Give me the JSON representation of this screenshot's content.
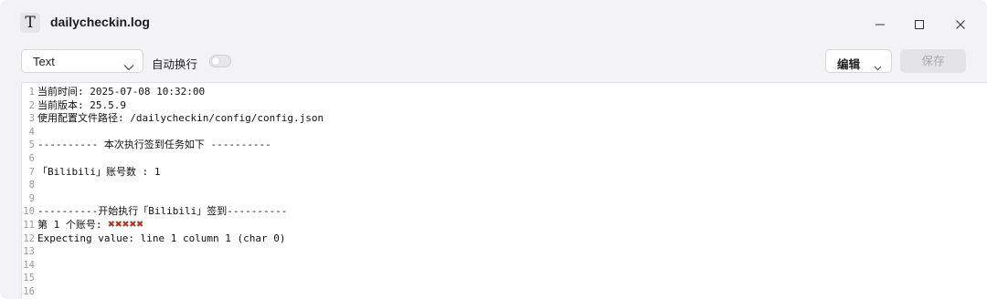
{
  "window": {
    "title": "dailycheckin.log",
    "app_icon_glyph": "T",
    "controls": [
      "minimize-icon",
      "maximize-icon",
      "close-icon"
    ]
  },
  "toolbar": {
    "mode_select": {
      "value": "Text"
    },
    "word_wrap_label": "自动换行",
    "word_wrap_on": false,
    "edit_label": "编辑",
    "save_label": "保存"
  },
  "editor": {
    "line_numbers": [
      "1",
      "2",
      "3",
      "4",
      "5",
      "6",
      "7",
      "8",
      "9",
      "10",
      "11",
      "12",
      "13",
      "14",
      "15",
      "16"
    ],
    "lines": [
      "当前时间: 2025-07-08 10:32:00",
      "当前版本: 25.5.9",
      "使用配置文件路径: /dailycheckin/config/config.json",
      "",
      "---------- 本次执行签到任务如下 ----------",
      "",
      "「Bilibili」账号数 : 1",
      "",
      "",
      "----------开始执行「Bilibili」签到----------",
      "第 1 个账号: ",
      "Expecting value: line 1 column 1 (char 0)",
      "",
      "",
      "",
      ""
    ],
    "line11_marks": "✖✖✖✖✖"
  },
  "colors": {
    "window_bg": "#f3f3f5",
    "editor_bg": "#ffffff",
    "mark_red": "#b3341f",
    "save_disabled_text": "#a9a9ae"
  }
}
